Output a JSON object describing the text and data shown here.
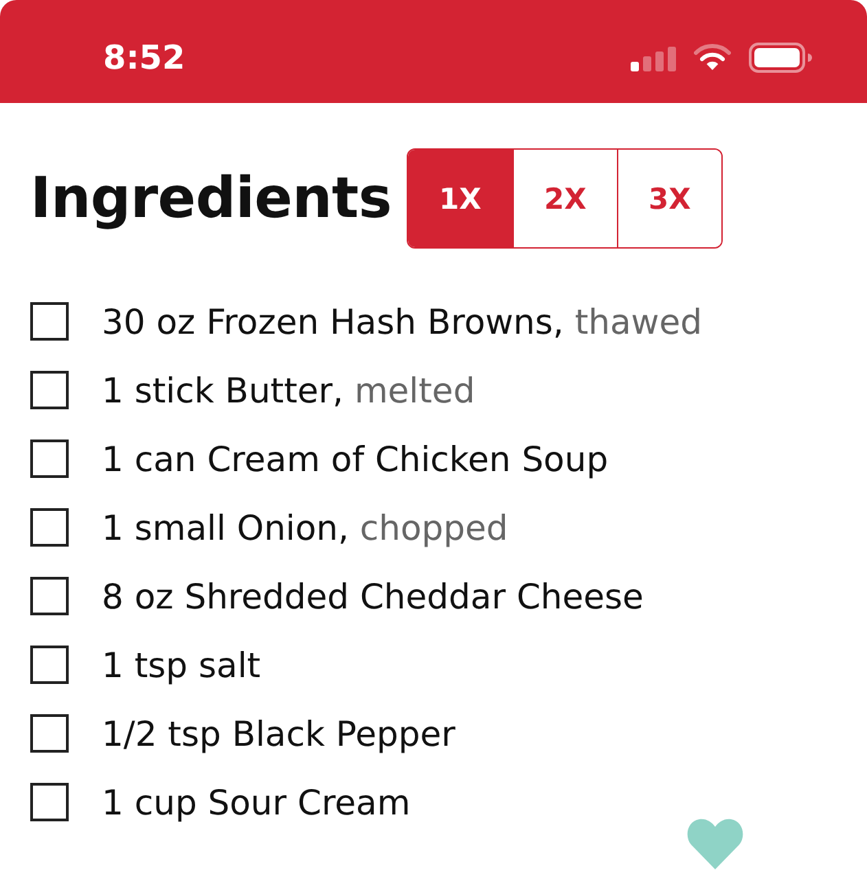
{
  "status_bar": {
    "time": "8:52"
  },
  "header": {
    "title": "Ingredients",
    "servings": [
      {
        "label": "1X",
        "selected": true
      },
      {
        "label": "2X",
        "selected": false
      },
      {
        "label": "3X",
        "selected": false
      }
    ]
  },
  "ingredients": [
    {
      "text": "30 oz Frozen Hash Browns,",
      "note": "thawed",
      "checked": false
    },
    {
      "text": "1 stick Butter,",
      "note": "melted",
      "checked": false
    },
    {
      "text": "1 can Cream of Chicken Soup",
      "checked": false
    },
    {
      "text": "1 small Onion,",
      "note": "chopped",
      "checked": false
    },
    {
      "text": "8 oz Shredded Cheddar Cheese",
      "checked": false
    },
    {
      "text": "1 tsp salt",
      "checked": false
    },
    {
      "text": "1/2 tsp Black Pepper",
      "checked": false
    },
    {
      "text": "1 cup Sour Cream",
      "checked": false
    }
  ]
}
